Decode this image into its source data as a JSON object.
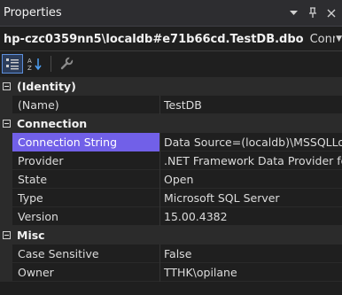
{
  "window": {
    "title": "Properties"
  },
  "selector": {
    "object_name": "hp-czc0359nn5\\localdb#e71b66cd.TestDB.dbo",
    "object_type": "Connection"
  },
  "icons": {
    "dropdown": "chevron-down-icon",
    "pin": "pin-icon",
    "close": "close-icon",
    "categorized": "categorized-icon",
    "alphabetical": "sort-alphabetical-icon",
    "property_pages": "wrench-icon",
    "collapse": "collapse-box-icon"
  },
  "categories": [
    {
      "label": "(Identity)",
      "properties": [
        {
          "name": "(Name)",
          "value": "TestDB"
        }
      ]
    },
    {
      "label": "Connection",
      "properties": [
        {
          "name": "Connection String",
          "value": "Data Source=(localdb)\\MSSQLLocalDB;Initial Catalog=TestDB"
        },
        {
          "name": "Provider",
          "value": ".NET Framework Data Provider for SQL Server"
        },
        {
          "name": "State",
          "value": "Open"
        },
        {
          "name": "Type",
          "value": "Microsoft SQL Server"
        },
        {
          "name": "Version",
          "value": "15.00.4382"
        }
      ]
    },
    {
      "label": "Misc",
      "properties": [
        {
          "name": "Case Sensitive",
          "value": "False"
        },
        {
          "name": "Owner",
          "value": "TTHK\\opilane"
        }
      ]
    }
  ],
  "selected_property": "Connection String",
  "colors": {
    "selection": "#7160e8",
    "background": "#1f1f1f",
    "category_background": "#2b2b2b"
  }
}
